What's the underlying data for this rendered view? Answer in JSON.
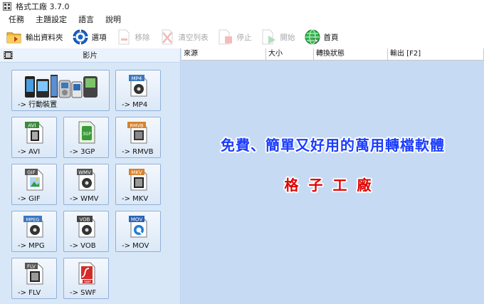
{
  "window": {
    "title": "格式工廠 3.7.0"
  },
  "menu": [
    "任務",
    "主題設定",
    "語言",
    "說明"
  ],
  "toolbar": [
    {
      "label": "輸出資料夾",
      "icon": "folder-icon",
      "enabled": true
    },
    {
      "label": "選項",
      "icon": "gear-icon",
      "enabled": true
    },
    {
      "label": "移除",
      "icon": "remove-file-icon",
      "enabled": false
    },
    {
      "label": "清空列表",
      "icon": "clear-list-icon",
      "enabled": false
    },
    {
      "label": "停止",
      "icon": "stop-icon",
      "enabled": false
    },
    {
      "label": "開始",
      "icon": "start-icon",
      "enabled": false
    },
    {
      "label": "首頁",
      "icon": "home-globe-icon",
      "enabled": true
    }
  ],
  "sidebar": {
    "header": "影片",
    "tiles": [
      {
        "label": "-> 行動裝置",
        "icon": "mobile-devices-icon",
        "badge": ""
      },
      {
        "label": "-> MP4",
        "icon": "mp4-file-icon",
        "badge": "MP4"
      },
      {
        "label": "-> AVI",
        "icon": "avi-file-icon",
        "badge": "AVI"
      },
      {
        "label": "-> 3GP",
        "icon": "3gp-file-icon",
        "badge": "3GP"
      },
      {
        "label": "-> RMVB",
        "icon": "rmvb-file-icon",
        "badge": "RMVB"
      },
      {
        "label": "-> GIF",
        "icon": "gif-file-icon",
        "badge": "GIF"
      },
      {
        "label": "-> WMV",
        "icon": "wmv-file-icon",
        "badge": "WMV"
      },
      {
        "label": "-> MKV",
        "icon": "mkv-file-icon",
        "badge": "MKV"
      },
      {
        "label": "-> MPG",
        "icon": "mpeg-file-icon",
        "badge": "MPEG"
      },
      {
        "label": "-> VOB",
        "icon": "vob-file-icon",
        "badge": "VOB"
      },
      {
        "label": "-> MOV",
        "icon": "mov-file-icon",
        "badge": "MOV"
      },
      {
        "label": "-> FLV",
        "icon": "flv-file-icon",
        "badge": "FLV"
      },
      {
        "label": "-> SWF",
        "icon": "swf-file-icon",
        "badge": "SWF"
      }
    ]
  },
  "task_list": {
    "columns": [
      "來源",
      "大小",
      "轉換狀態",
      "輸出 [F2]"
    ]
  },
  "promo": {
    "line1": "免費、簡單又好用的萬用轉檔軟體",
    "line2": "格子工廠"
  },
  "colors": {
    "promo_blue": "#1a3cff",
    "promo_red": "#e00000",
    "panel_bg": "#c6daf3",
    "tile_border": "#8fb0d8"
  }
}
